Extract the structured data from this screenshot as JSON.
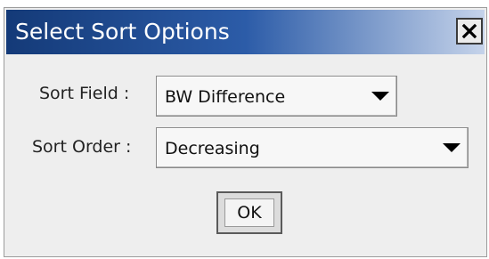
{
  "dialog": {
    "title": "Select Sort Options",
    "close_icon": "close-x-icon"
  },
  "sort_field": {
    "label": "Sort Field :",
    "value": "BW Difference",
    "dropdown_icon": "triangle-down-icon"
  },
  "sort_order": {
    "label": "Sort Order :",
    "value": "Decreasing",
    "dropdown_icon": "triangle-down-icon"
  },
  "actions": {
    "ok_label": "OK"
  },
  "colors": {
    "titlebar_start": "#143a78",
    "titlebar_end": "#c5d3ea",
    "dialog_background": "#eeeeee"
  }
}
